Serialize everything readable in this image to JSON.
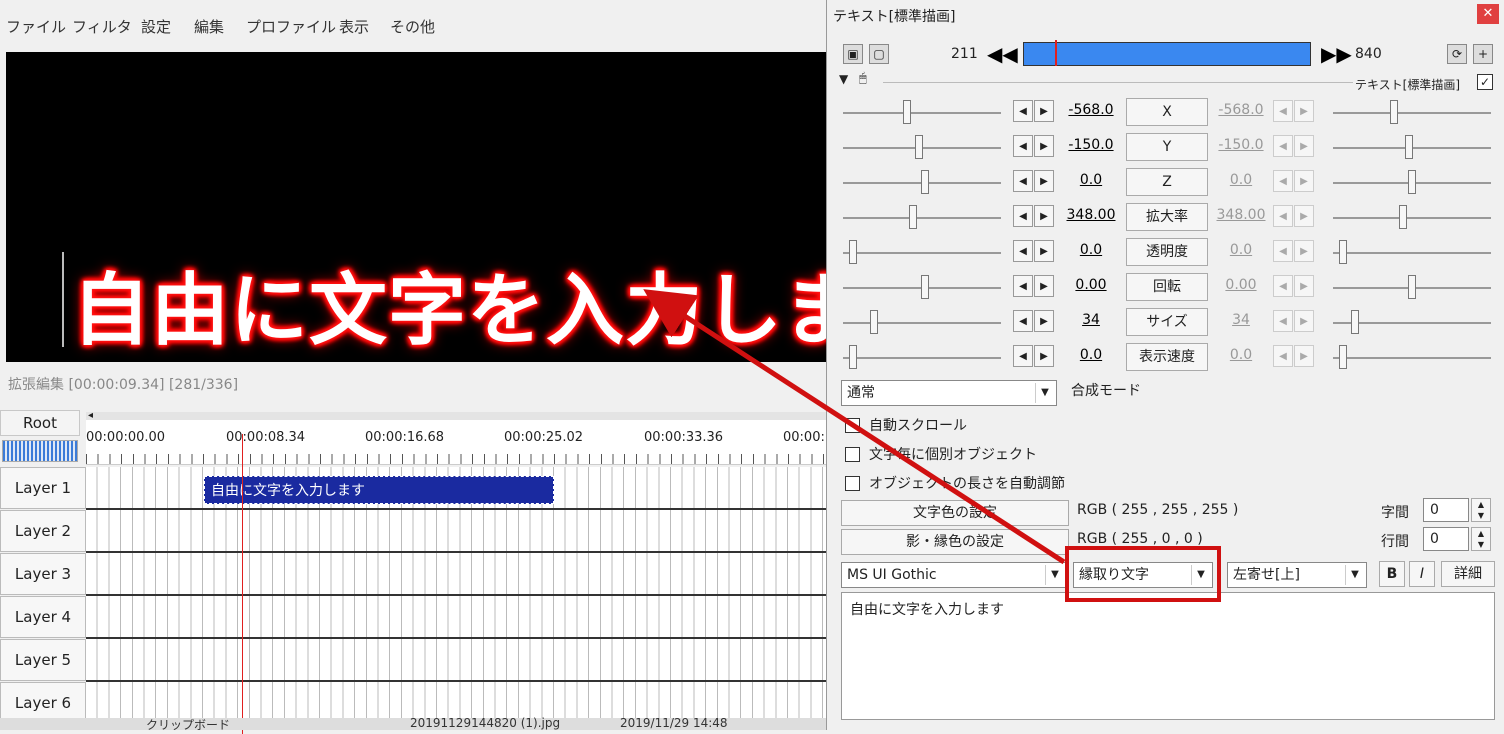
{
  "menu": [
    "ファイル",
    "フィルタ",
    "設定",
    "編集",
    "プロファイル",
    "表示",
    "その他"
  ],
  "preview": {
    "overlay_text": "自由に文字を入力します"
  },
  "status": "拡張編集 [00:00:09.34] [281/336]",
  "timeline": {
    "root_label": "Root",
    "times": [
      "00:00:00.00",
      "00:00:08.34",
      "00:00:16.68",
      "00:00:25.02",
      "00:00:33.36",
      "00:00:"
    ],
    "layers": [
      "Layer 1",
      "Layer 2",
      "Layer 3",
      "Layer 4",
      "Layer 5",
      "Layer 6"
    ],
    "clip_label": "自由に文字を入力します",
    "bottom": [
      "クリップボード",
      "20191129144820 (1).jpg",
      "2019/11/29 14:48"
    ]
  },
  "dialog": {
    "title": "テキスト[標準描画]",
    "close": "✕",
    "frame_start": "211",
    "frame_end": "840",
    "object_name": "テキスト[標準描画]",
    "params": [
      {
        "name": "X",
        "start": "-568.0",
        "end": "-568.0",
        "slider": 0.4,
        "slider_end": 0.38
      },
      {
        "name": "Y",
        "start": "-150.0",
        "end": "-150.0",
        "slider": 0.48,
        "slider_end": 0.48
      },
      {
        "name": "Z",
        "start": "0.0",
        "end": "0.0",
        "slider": 0.52,
        "slider_end": 0.5
      },
      {
        "name": "拡大率",
        "start": "348.00",
        "end": "348.00",
        "slider": 0.44,
        "slider_end": 0.44
      },
      {
        "name": "透明度",
        "start": "0.0",
        "end": "0.0",
        "slider": 0.04,
        "slider_end": 0.04
      },
      {
        "name": "回転",
        "start": "0.00",
        "end": "0.00",
        "slider": 0.52,
        "slider_end": 0.5
      },
      {
        "name": "サイズ",
        "start": "34",
        "end": "34",
        "slider": 0.18,
        "slider_end": 0.12
      },
      {
        "name": "表示速度",
        "start": "0.0",
        "end": "0.0",
        "slider": 0.04,
        "slider_end": 0.04
      }
    ],
    "blend_value": "通常",
    "blend_label": "合成モード",
    "checkboxes": [
      "自動スクロール",
      "文字毎に個別オブジェクト",
      "オブジェクトの長さを自動調節"
    ],
    "text_color_btn": "文字色の設定",
    "text_color_value": "RGB ( 255 , 255 , 255 )",
    "shadow_color_btn": "影・縁色の設定",
    "shadow_color_value": "RGB ( 255 , 0 , 0 )",
    "char_spacing_label": "字間",
    "char_spacing": "0",
    "line_spacing_label": "行間",
    "line_spacing": "0",
    "font": "MS UI Gothic",
    "decoration": "縁取り文字",
    "align": "左寄せ[上]",
    "bold": "B",
    "italic": "I",
    "detail": "詳細",
    "text": "自由に文字を入力します"
  },
  "colors": {
    "accent_red": "#d01010",
    "clip_blue": "#1a2aa0",
    "frame_bar": "#3a88f0"
  }
}
